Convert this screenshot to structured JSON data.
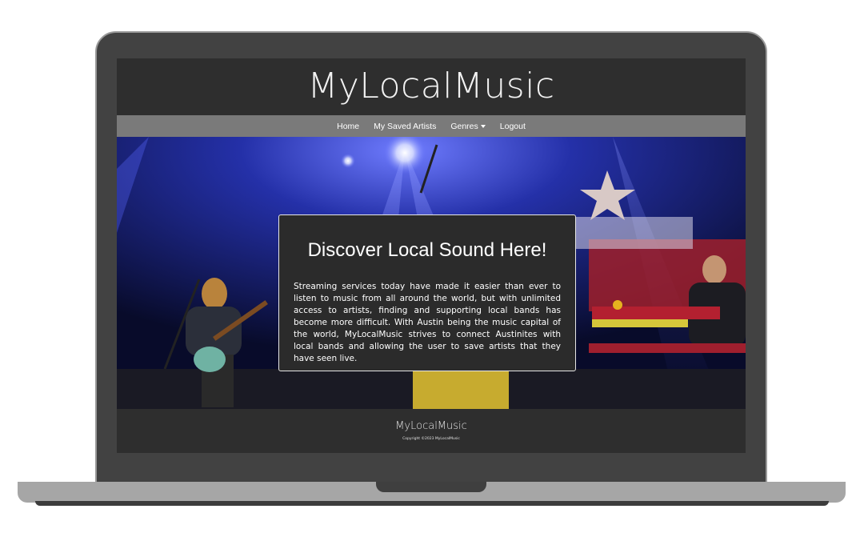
{
  "site": {
    "title": "MyLocalMusic"
  },
  "nav": {
    "items": [
      {
        "label": "Home"
      },
      {
        "label": "My Saved Artists"
      },
      {
        "label": "Genres"
      },
      {
        "label": "Logout"
      }
    ]
  },
  "hero": {
    "heading": "Discover Local Sound Here!",
    "text": "Streaming services today have made it easier than ever to listen to music from all around the world, but with unlimited access to artists, finding and supporting local bands has become more difficult. With Austin being the music capital of the world, MyLocalMusic strives to connect Austinites with local bands and allowing the user to save artists that they have seen live."
  },
  "footer": {
    "title": "MyLocalMusic",
    "copyright": "Copyright ©2023 MyLocalMusic"
  },
  "colors": {
    "header_bg": "#2e2e2e",
    "navbar_bg": "#7a7a7a",
    "card_bg": "#2b2b2b",
    "laptop_frame": "#424242",
    "laptop_base": "#a6a6a6"
  }
}
